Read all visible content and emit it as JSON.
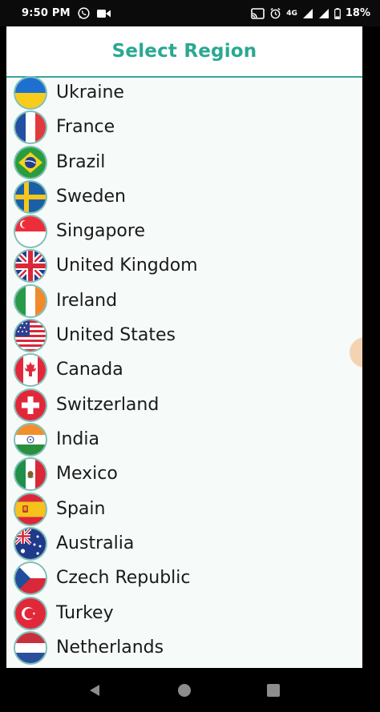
{
  "status_bar": {
    "time": "9:50 PM",
    "network": "4G",
    "battery": "18%"
  },
  "header": {
    "title": "Select Region"
  },
  "regions": [
    {
      "label": "Ukraine",
      "flag_icon": "ukraine-flag-icon"
    },
    {
      "label": "France",
      "flag_icon": "france-flag-icon"
    },
    {
      "label": "Brazil",
      "flag_icon": "brazil-flag-icon"
    },
    {
      "label": "Sweden",
      "flag_icon": "sweden-flag-icon"
    },
    {
      "label": "Singapore",
      "flag_icon": "singapore-flag-icon"
    },
    {
      "label": "United Kingdom",
      "flag_icon": "united-kingdom-flag-icon"
    },
    {
      "label": "Ireland",
      "flag_icon": "ireland-flag-icon"
    },
    {
      "label": "United States",
      "flag_icon": "united-states-flag-icon"
    },
    {
      "label": "Canada",
      "flag_icon": "canada-flag-icon"
    },
    {
      "label": "Switzerland",
      "flag_icon": "switzerland-flag-icon"
    },
    {
      "label": "India",
      "flag_icon": "india-flag-icon"
    },
    {
      "label": "Mexico",
      "flag_icon": "mexico-flag-icon"
    },
    {
      "label": "Spain",
      "flag_icon": "spain-flag-icon"
    },
    {
      "label": "Australia",
      "flag_icon": "australia-flag-icon"
    },
    {
      "label": "Czech Republic",
      "flag_icon": "czech-republic-flag-icon"
    },
    {
      "label": "Turkey",
      "flag_icon": "turkey-flag-icon"
    },
    {
      "label": "Netherlands",
      "flag_icon": "netherlands-flag-icon"
    }
  ],
  "colors": {
    "accent": "#2aa892",
    "header_rule": "#3aa59a",
    "background": "#f6fbfa"
  }
}
